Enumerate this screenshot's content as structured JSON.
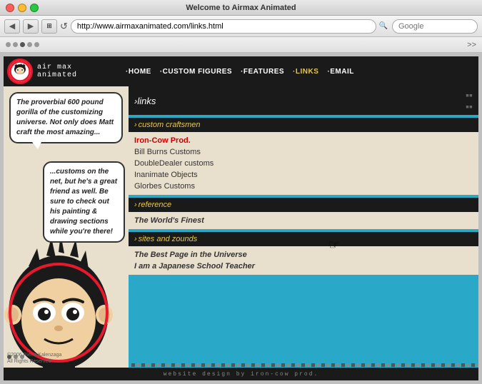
{
  "window": {
    "title": "Welcome to Airmax Animated"
  },
  "browser": {
    "address": "http://www.airmaxanimated.com/links.html",
    "search_placeholder": "Google",
    "back_label": "◀",
    "forward_label": "▶",
    "refresh_label": "↺"
  },
  "site": {
    "logo_text": "air max animated",
    "nav": {
      "home": "·HOME",
      "custom_figures": "·CUSTOM FIGURES",
      "features": "·FEATURES",
      "links": "·LINKS",
      "email": "·EMAIL"
    },
    "links_heading": "links",
    "sections": {
      "custom_craftsmen": {
        "heading": "custom craftsmen",
        "items": [
          {
            "label": "Iron-Cow Prod.",
            "highlighted": true
          },
          {
            "label": "Bill Burns Customs",
            "highlighted": false
          },
          {
            "label": "DoubleDealer customs",
            "highlighted": false
          },
          {
            "label": "Inanimate Objects",
            "highlighted": false
          },
          {
            "label": "Glorbes Customs",
            "highlighted": false
          }
        ]
      },
      "reference": {
        "heading": "reference",
        "items": [
          {
            "label": "The World's Finest",
            "highlighted": false,
            "italic": true
          }
        ]
      },
      "sites_and_zounds": {
        "heading": "sites and zounds",
        "items": [
          {
            "label": "The Best Page in the Universe",
            "highlighted": false,
            "italic": true
          },
          {
            "label": "I am a Japanese School Teacher",
            "highlighted": false,
            "italic": true
          }
        ]
      }
    },
    "comic": {
      "bubble1": "The proverbial 600 pound gorilla of the customizing universe. Not only does Matt craft the most amazing...",
      "bubble2": "...customs on the net, but he's a great friend as well. Be sure to check out his painting & drawing sections while you're there!"
    },
    "copyright": "©2006 Pierre Kalenzaga\nAll Rights Reserved.",
    "footer": "website design by iron-cow prod."
  }
}
